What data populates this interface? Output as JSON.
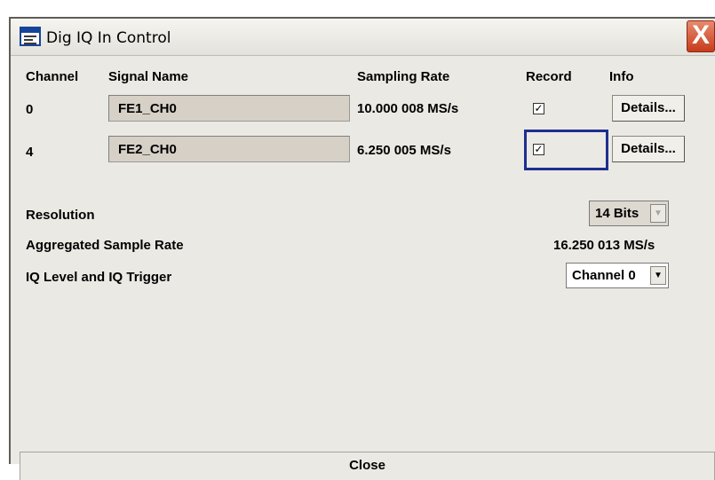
{
  "window": {
    "title": "Dig IQ In Control",
    "close_glyph": "X",
    "icon": "window-app-icon"
  },
  "table": {
    "headers": [
      "Channel",
      "Signal Name",
      "Sampling Rate",
      "Record",
      "Info"
    ],
    "rows": [
      {
        "channel": "0",
        "signal_name": "FE1_CH0",
        "sampling_rate": "10.000 008 MS/s",
        "record": true,
        "info_label": "Details..."
      },
      {
        "channel": "4",
        "signal_name": "FE2_CH0",
        "sampling_rate": "6.250 005 MS/s",
        "record": true,
        "info_label": "Details..."
      }
    ]
  },
  "settings": {
    "resolution_label": "Resolution",
    "resolution_value": "14 Bits",
    "aggregated_label": "Aggregated Sample Rate",
    "aggregated_value": "16.250 013 MS/s",
    "iq_trigger_label": "IQ Level and IQ Trigger",
    "iq_trigger_value": "Channel 0"
  },
  "footer": {
    "close_label": "Close"
  },
  "colors": {
    "focus_border": "#1e2f8f",
    "close_button": "#c63c1c",
    "background": "#ebe9e4"
  }
}
